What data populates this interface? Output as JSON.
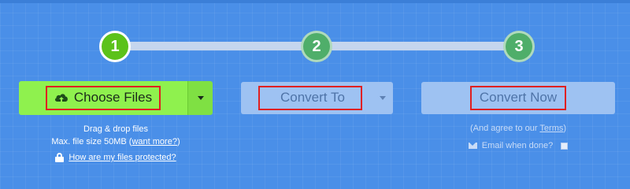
{
  "steps": [
    "1",
    "2",
    "3"
  ],
  "choose_files": {
    "label": "Choose Files",
    "icon": "cloud-upload-icon",
    "color": "#8ff14e"
  },
  "convert_to": {
    "label": "Convert To"
  },
  "convert_now": {
    "label": "Convert Now"
  },
  "upload_info": {
    "drag_drop": "Drag & drop files",
    "max_size": "Max. file size 50MB",
    "want_more": "want more?",
    "protected_link": "How are my files protected?"
  },
  "agree_info": {
    "prefix": "(And agree to our ",
    "terms_link": "Terms",
    "suffix": ")",
    "email_label": "Email when done?"
  },
  "colors": {
    "background": "#4a8fe8",
    "step_active": "#5cc21a",
    "step_inactive": "#4fae6a",
    "highlight_box": "#e02020"
  }
}
